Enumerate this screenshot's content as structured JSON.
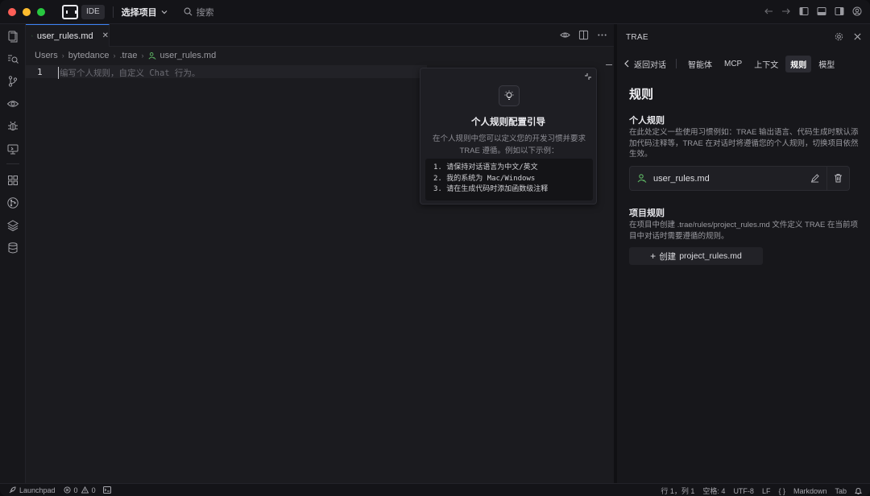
{
  "titlebar": {
    "traffic_colors": [
      "#ff5f57",
      "#febc2e",
      "#28c840"
    ],
    "mode_badge": "IDE",
    "project_label": "选择项目",
    "search_label": "搜索"
  },
  "editor": {
    "tab_label": "user_rules.md",
    "breadcrumbs": [
      "Users",
      "bytedance",
      ".trae",
      "user_rules.md"
    ],
    "line_number": "1",
    "placeholder": "编写个人规则，自定义 Chat 行为。",
    "guide": {
      "title": "个人规则配置引导",
      "description": "在个人规则中您可以定义您的开发习惯并要求 TRAE 遵循。例如以下示例：",
      "examples": [
        "1. 请保持对话语言为中文/英文",
        "2. 我的系统为 Mac/Windows",
        "3. 请在生成代码时添加函数级注释"
      ]
    }
  },
  "panel": {
    "title": "TRAE",
    "back_label": "返回对话",
    "nav_items": [
      "智能体",
      "MCP",
      "上下文",
      "规则",
      "模型"
    ],
    "active_nav": "规则",
    "heading": "规则",
    "personal": {
      "title": "个人规则",
      "description": "在此处定义一些使用习惯例如：TRAE 输出语言、代码生成时默认添加代码注释等，TRAE 在对话时将遵循您的个人规则，切换项目依然生效。",
      "file_name": "user_rules.md"
    },
    "project": {
      "title": "项目规则",
      "description": "在项目中创建 .trae/rules/project_rules.md 文件定义 TRAE 在当前项目中对话时需要遵循的规则。",
      "create_prefix": "创建",
      "create_file": "project_rules.md"
    }
  },
  "statusbar": {
    "launchpad": "Launchpad",
    "errors": "0",
    "warnings": "0",
    "position": "行 1，列 1",
    "spaces": "空格: 4",
    "encoding": "UTF-8",
    "eol": "LF",
    "braces": "{ }",
    "language": "Markdown",
    "tab": "Tab"
  }
}
